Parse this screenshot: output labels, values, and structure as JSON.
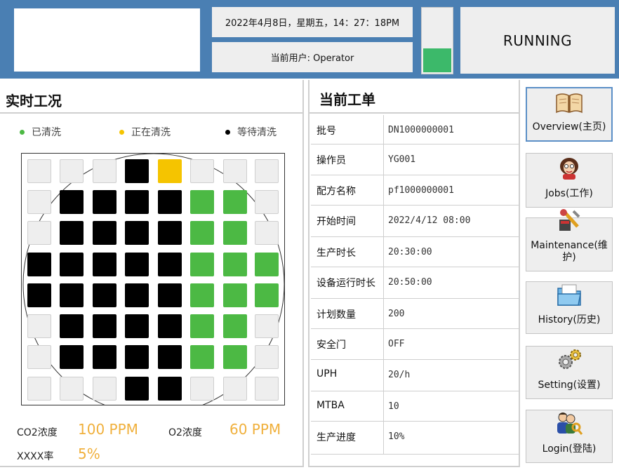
{
  "header": {
    "datetime": "2022年4月8日，星期五，14：27：18PM",
    "user": "当前用户: Operator",
    "status": "RUNNING",
    "status_lamp_color": "#3cb96a",
    "header_color": "#4a7fb3"
  },
  "realtime": {
    "title": "实时工况",
    "legend": [
      {
        "label": "已清洗",
        "color": "#4cb944"
      },
      {
        "label": "正在清洗",
        "color": "#f5c400"
      },
      {
        "label": "等待清洗",
        "color": "#000000"
      }
    ],
    "grid_states": [
      "EEEBYEEE",
      "EBBBBGGE",
      "EBBBBGGE",
      "BBBBBGGG",
      "BBBBBGGG",
      "EBBBBGGE",
      "EBBBBGGE",
      "EEEBBEEE"
    ],
    "state_colors": {
      "E": "#eeeeee",
      "B": "#000000",
      "G": "#4cb944",
      "Y": "#f5c400"
    },
    "co2_label": "CO2浓度",
    "co2_value": "100 PPM",
    "o2_label": "O2浓度",
    "o2_value": "60 PPM",
    "rate_label": "XXXX率",
    "rate_value": "5%"
  },
  "order": {
    "title": "当前工单",
    "rows": [
      {
        "label": "批号",
        "value": "DN1000000001"
      },
      {
        "label": "操作员",
        "value": "YG001"
      },
      {
        "label": "配方名称",
        "value": "pf1000000001"
      },
      {
        "label": "开始时间",
        "value": "2022/4/12  08:00"
      },
      {
        "label": "生产时长",
        "value": "20:30:00"
      },
      {
        "label": "设备运行时长",
        "value": "20:50:00"
      },
      {
        "label": "计划数量",
        "value": "200"
      },
      {
        "label": "安全门",
        "value": "OFF"
      },
      {
        "label": "UPH",
        "value": "20/h"
      },
      {
        "label": "MTBA",
        "value": "10"
      },
      {
        "label": "生产进度",
        "value": "10%"
      }
    ]
  },
  "nav": [
    {
      "label": "Overview(主页)",
      "icon": "book-icon",
      "active": true
    },
    {
      "label": "Jobs(工作)",
      "icon": "person-icon",
      "active": false
    },
    {
      "label": "Maintenance(维护)",
      "icon": "tools-icon",
      "active": false
    },
    {
      "label": "History(历史)",
      "icon": "folder-icon",
      "active": false
    },
    {
      "label": "Setting(设置)",
      "icon": "gears-icon",
      "active": false
    },
    {
      "label": "Login(登陆)",
      "icon": "users-key-icon",
      "active": false
    }
  ]
}
